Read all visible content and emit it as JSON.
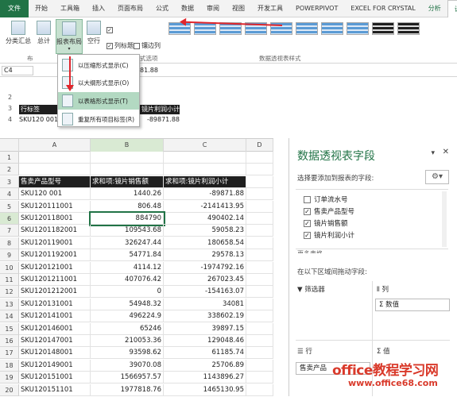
{
  "ribbon": {
    "tabs": [
      "文件",
      "开始",
      "工具箱",
      "插入",
      "页面布局",
      "公式",
      "数据",
      "审阅",
      "视图",
      "开发工具",
      "POWERPIVOT",
      "EXCEL FOR CRYSTAL",
      "分析",
      "设计"
    ],
    "subtotal": "分类汇总",
    "grand_total": "总计",
    "report_layout": "报表布局",
    "blank_rows": "空行",
    "layout_group": "布",
    "col_headers": "列标题",
    "banded_cols": "镶边列",
    "style_options_group": "式选项",
    "styles_group": "数据透视表样式"
  },
  "menu": {
    "items": [
      "以压缩形式显示(C)",
      "以大纲形式显示(O)",
      "以表格形式显示(T)",
      "重复所有项目标签(R)"
    ]
  },
  "formula": {
    "name_box": "C4",
    "value": "81.88"
  },
  "mini": {
    "rows": [
      "2",
      "3",
      "4"
    ],
    "header": "行标签",
    "c3": "镜片利润小计",
    "b4": "SKU120 001",
    "c4": "-89871.88"
  },
  "columns": [
    "A",
    "B",
    "C",
    "D"
  ],
  "rows": [
    "1",
    "2",
    "3",
    "4",
    "5",
    "6",
    "7",
    "8",
    "9",
    "10",
    "11",
    "12",
    "13",
    "14",
    "15",
    "16",
    "17",
    "18",
    "19",
    "20"
  ],
  "table": {
    "headers": [
      "售卖产品型号",
      "求和项:镜片销售额",
      "求和项:镜片利润小计"
    ],
    "data": [
      [
        "SKU120 001",
        "1440.26",
        "-89871.88"
      ],
      [
        "SKU120111001",
        "806.48",
        "-2141413.95"
      ],
      [
        "SKU120118001",
        "884790",
        "490402.14"
      ],
      [
        "SKU1201182001",
        "109543.68",
        "59058.23"
      ],
      [
        "SKU120119001",
        "326247.44",
        "180658.54"
      ],
      [
        "SKU1201192001",
        "54771.84",
        "29578.13"
      ],
      [
        "SKU120121001",
        "4114.12",
        "-1974792.16"
      ],
      [
        "SKU1201211001",
        "407076.42",
        "267023.45"
      ],
      [
        "SKU1201212001",
        "0",
        "-154163.07"
      ],
      [
        "SKU120131001",
        "54948.32",
        "34081"
      ],
      [
        "SKU120141001",
        "496224.9",
        "338602.19"
      ],
      [
        "SKU120146001",
        "65246",
        "39897.15"
      ],
      [
        "SKU120147001",
        "210053.36",
        "129048.46"
      ],
      [
        "SKU120148001",
        "93598.62",
        "61185.74"
      ],
      [
        "SKU120149001",
        "39070.08",
        "25706.89"
      ],
      [
        "SKU120151001",
        "1566957.57",
        "1143896.27"
      ],
      [
        "SKU120151101",
        "1977818.76",
        "1465130.95"
      ]
    ]
  },
  "pane": {
    "title": "数据透视表字段",
    "subtitle": "选择要添加到报表的字段:",
    "fields": [
      {
        "label": "订单流水号",
        "checked": false
      },
      {
        "label": "售卖产品型号",
        "checked": true
      },
      {
        "label": "镜片销售额",
        "checked": true
      },
      {
        "label": "镜片利润小计",
        "checked": true
      }
    ],
    "more": "更多表格",
    "drag_hint": "在以下区域间拖动字段:",
    "filters": "筛选器",
    "columns": "列",
    "values_item": "Σ 数值",
    "rows": "行",
    "values": "Σ 值",
    "row_item": "售卖产品",
    "check_mark": "✓"
  },
  "watermark": {
    "main": "office教程学习网",
    "url": "www.office68.com"
  },
  "colors": {
    "accent": "#217346",
    "highlight": "#b3d9c2",
    "arrow": "#e0262c",
    "table_header": "#1f1f1f"
  }
}
